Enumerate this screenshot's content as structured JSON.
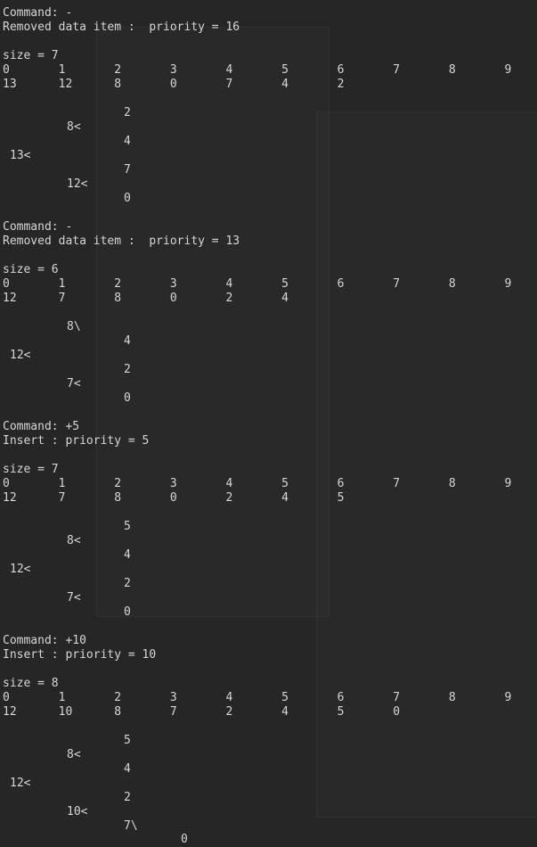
{
  "console": {
    "background": "#262626",
    "text_color": "#d6d6d6",
    "lines": [
      "Command: -",
      "Removed data item :  priority = 16",
      "size = 7",
      "0       1       2       3       4       5       6       7       8       9",
      "13      12      8       0       7       4       2",
      "2",
      "8<",
      "4",
      "13<",
      "7",
      "12<",
      "0",
      "Command: -",
      "Removed data item :  priority = 13",
      "size = 6",
      "0       1       2       3       4       5       6       7       8       9",
      "12      7       8       0       2       4",
      "8\\",
      "4",
      "12<",
      "2",
      "7<",
      "0",
      "Command: +5",
      "Insert : priority = 5",
      "size = 7",
      "0       1       2       3       4       5       6       7       8       9",
      "12      7       8       0       2       4       5",
      "5",
      "8<",
      "4",
      "12<",
      "2",
      "7<",
      "0",
      "Command: +10",
      "Insert : priority = 10",
      "size = 8",
      "0       1       2       3       4       5       6       7       8       9",
      "12      10      8       7       2       4       5       0",
      "5",
      "8<",
      "4",
      "12<",
      "2",
      "10<",
      "7\\",
      "0"
    ]
  }
}
